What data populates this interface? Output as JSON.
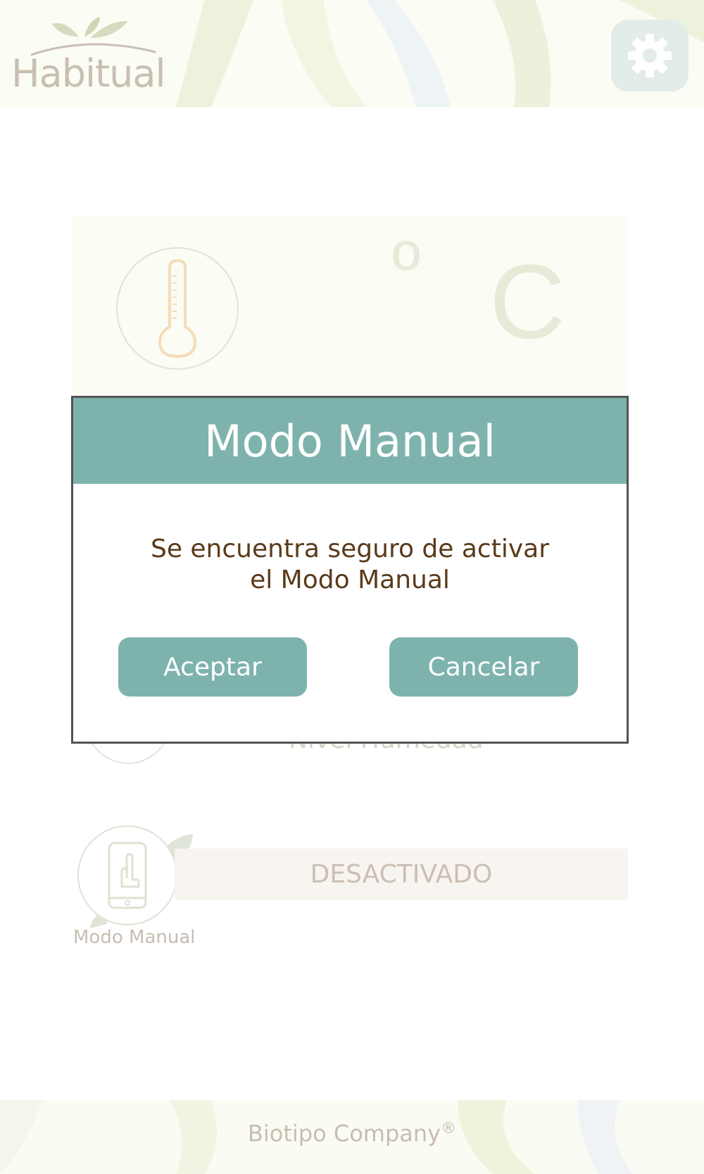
{
  "header": {
    "logo_text": "Habitual",
    "settings_icon": "gear-icon"
  },
  "temperature": {
    "icon": "thermometer-icon",
    "degree_symbol": "º",
    "unit": "C"
  },
  "humidity": {
    "label": "Nivel Humedad"
  },
  "manual_mode": {
    "icon": "phone-touch-icon",
    "caption": "Modo Manual",
    "status": "DESACTIVADO"
  },
  "dialog": {
    "title": "Modo Manual",
    "message_line1": "Se encuentra seguro de activar",
    "message_line2": "el Modo Manual",
    "accept_label": "Aceptar",
    "cancel_label": "Cancelar"
  },
  "footer": {
    "company": "Biotipo Company",
    "trademark": "®"
  },
  "colors": {
    "accent": "#7db3ac",
    "dialog_text": "#5a3a1a",
    "dialog_border": "#545454"
  }
}
